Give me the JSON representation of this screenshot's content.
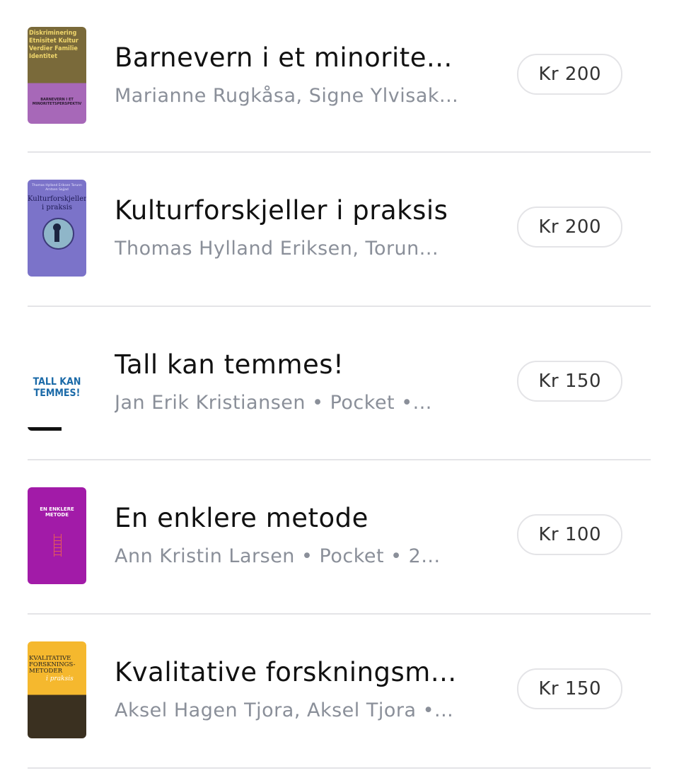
{
  "books": [
    {
      "title": "Barnevern i et minorite...",
      "subtitle": "Marianne Rugkåsa, Signe Ylvisak...",
      "price": "Kr 200",
      "cover_text": "Diskriminering Etnisitet Kultur Verdier Familie Identitet",
      "cover_bottom": "BARNEVERN I ET MINORITETSPERSPEKTIV"
    },
    {
      "title": "Kulturforskjeller i praksis",
      "subtitle": "Thomas Hylland Eriksen, Torun...",
      "price": "Kr 200",
      "cover_authors": "Thomas Hylland Eriksen Torunn Arntsen Sajjad",
      "cover_title": "Kulturforskjeller i praksis"
    },
    {
      "title": "Tall kan temmes!",
      "subtitle": "Jan Erik Kristiansen • Pocket •...",
      "price": "Kr 150",
      "cover_title": "TALL KAN TEMMES!"
    },
    {
      "title": "En enklere metode",
      "subtitle": "Ann Kristin Larsen • Pocket • 2...",
      "price": "Kr 100",
      "cover_title": "EN ENKLERE METODE"
    },
    {
      "title": "Kvalitative forskningsm...",
      "subtitle": "Aksel Hagen Tjora, Aksel Tjora •...",
      "price": "Kr 150",
      "cover_title": "KVALITATIVE FORSKNINGS- METODER",
      "cover_sub": "i praksis"
    }
  ]
}
